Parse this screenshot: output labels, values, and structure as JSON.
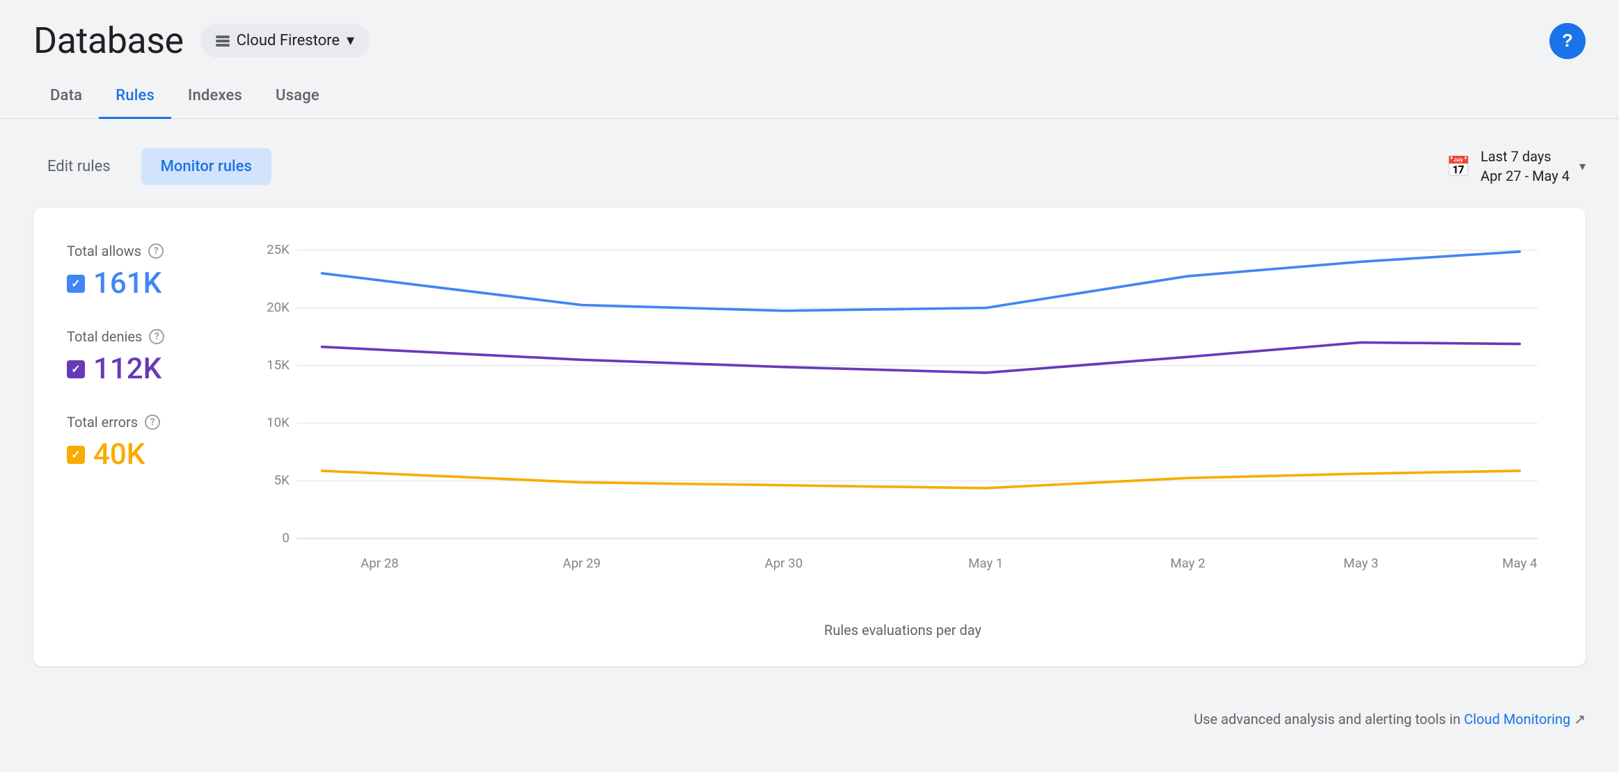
{
  "header": {
    "title": "Database",
    "service_label": "Cloud Firestore",
    "help_label": "?"
  },
  "nav": {
    "tabs": [
      {
        "id": "data",
        "label": "Data",
        "active": false
      },
      {
        "id": "rules",
        "label": "Rules",
        "active": true
      },
      {
        "id": "indexes",
        "label": "Indexes",
        "active": false
      },
      {
        "id": "usage",
        "label": "Usage",
        "active": false
      }
    ]
  },
  "toolbar": {
    "edit_rules_label": "Edit rules",
    "monitor_rules_label": "Monitor rules",
    "date_range_line1": "Last 7 days",
    "date_range_line2": "Apr 27 - May 4"
  },
  "legend": {
    "allows": {
      "label": "Total allows",
      "value": "161K",
      "color": "blue"
    },
    "denies": {
      "label": "Total denies",
      "value": "112K",
      "color": "purple"
    },
    "errors": {
      "label": "Total errors",
      "value": "40K",
      "color": "yellow"
    }
  },
  "chart": {
    "y_labels": [
      "25K",
      "20K",
      "15K",
      "10K",
      "5K",
      "0"
    ],
    "x_labels": [
      "Apr 28",
      "Apr 29",
      "Apr 30",
      "May 1",
      "May 2",
      "May 3",
      "May 4"
    ],
    "x_axis_label": "Rules evaluations per day"
  },
  "footer": {
    "text": "Use advanced analysis and alerting tools in ",
    "link_label": "Cloud Monitoring",
    "ext_icon": "↗"
  },
  "icons": {
    "stack": "≡",
    "chevron_down": "▾",
    "calendar": "📅"
  }
}
